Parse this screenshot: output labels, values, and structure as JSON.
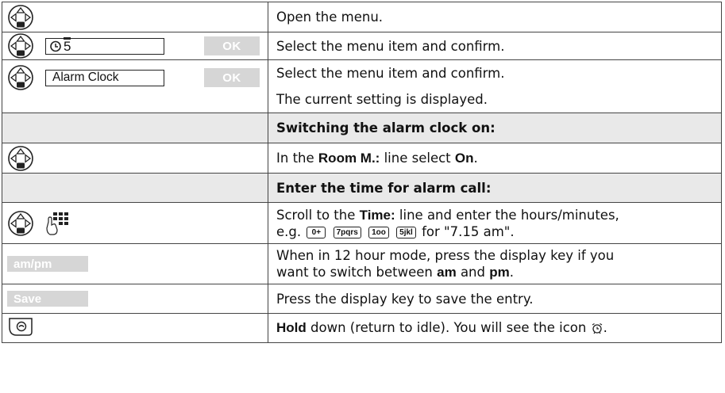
{
  "rows": [
    {
      "text": "Open the menu."
    },
    {
      "field": "5",
      "ok": "OK",
      "text": "Select the menu item and confirm."
    },
    {
      "field": "Alarm Clock",
      "ok": "OK",
      "text": "Select the menu item and confirm."
    },
    {
      "text": "The current setting is displayed."
    },
    {
      "text": "Switching the alarm clock on:"
    },
    {
      "pre": "In the",
      "bold1": "Room M.:",
      "mid": "line select",
      "bold2": "On",
      "post": "."
    },
    {
      "text": "Enter the time for alarm call:"
    },
    {
      "pre": "Scroll to the",
      "bold1": "Time:",
      "post1": "line and enter the hours/minutes,",
      "line2_pre": "e.g.",
      "keys": [
        "0+",
        "7pqrs",
        "1oo",
        "5jkl"
      ],
      "line2_post": "for \"7.15 am\"."
    },
    {
      "softkey": "am/pm",
      "line1": "When in 12 hour mode, press the display key if you",
      "line2_pre": "want to switch between",
      "bold1": "am",
      "mid": "and",
      "bold2": "pm",
      "post": "."
    },
    {
      "softkey": "Save",
      "text": "Press the display key to save the entry."
    },
    {
      "bold1": "Hold",
      "post": "down (return to idle). You will see the icon"
    }
  ],
  "colors": {
    "softkey_bg": "#d6d6d6",
    "border": "#444444",
    "shade": "#e9e9e9"
  },
  "icons": [
    "nav-key-icon",
    "clock-menu-icon",
    "keypad-icon",
    "end-call-key-icon",
    "alarm-clock-icon"
  ]
}
